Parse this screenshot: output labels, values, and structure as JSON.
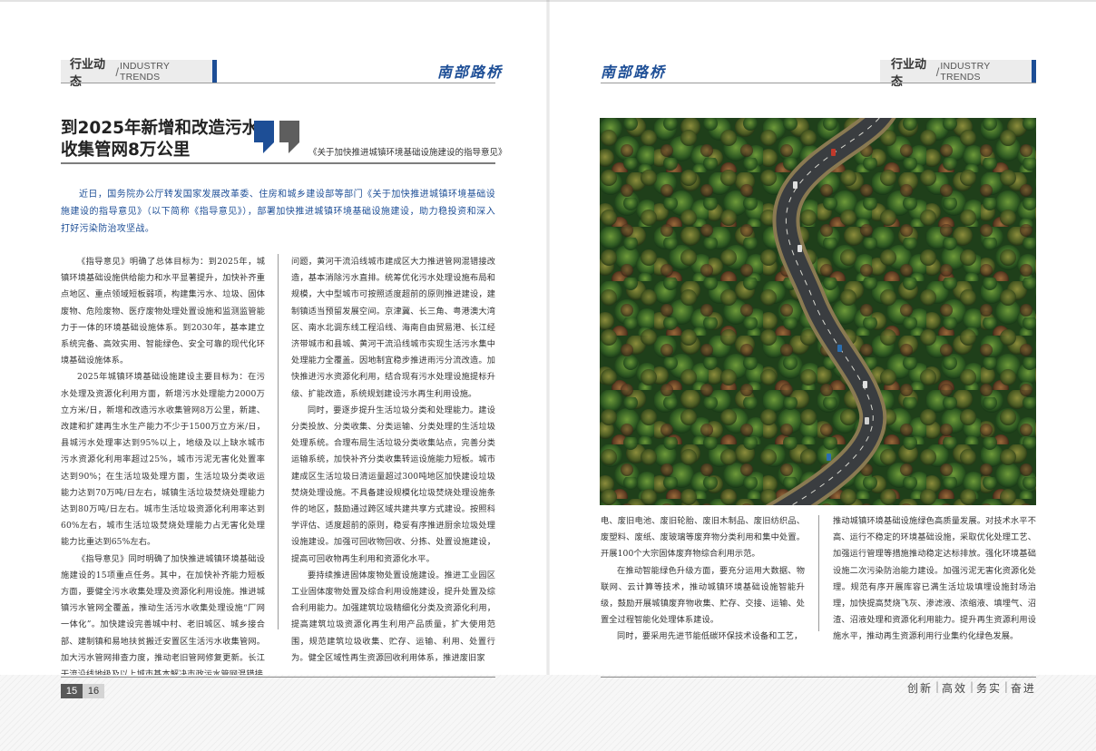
{
  "header": {
    "section_cn": "行业动态",
    "section_slash": "/",
    "section_en": "INDUSTRY TRENDS",
    "logo": "南部路桥",
    "colors": {
      "accent": "#1d4e96",
      "tab_bg": "#ececec"
    }
  },
  "article": {
    "title_line1": "到2025年新增和改造污水",
    "title_line2": "收集管网8万公里",
    "quote_icon": "quote-mark-icon",
    "subtitle": "《关于加快推进城镇环境基础设施建设的指导意见》",
    "lead": "近日，国务院办公厅转发国家发展改革委、住房和城乡建设部等部门《关于加快推进城镇环境基础设施建设的指导意见》（以下简称《指导意见》），部署加快推进城镇环境基础设施建设，助力稳投资和深入打好污染防治攻坚战。",
    "col1": [
      "《指导意见》明确了总体目标为：到2025年，城镇环境基础设施供给能力和水平显著提升，加快补齐重点地区、重点领域短板弱项，构建集污水、垃圾、固体废物、危险废物、医疗废物处理处置设施和监测监管能力于一体的环境基础设施体系。到2030年，基本建立系统完备、高效实用、智能绿色、安全可靠的现代化环境基础设施体系。",
      "2025年城镇环境基础设施建设主要目标为：在污水处理及资源化利用方面，新增污水处理能力2000万立方米/日，新增和改造污水收集管网8万公里，新建、改建和扩建再生水生产能力不少于1500万立方米/日，县城污水处理率达到95%以上，地级及以上缺水城市污水资源化利用率超过25%，城市污泥无害化处置率达到90%；在生活垃圾处理方面，生活垃圾分类收运能力达到70万吨/日左右，城镇生活垃圾焚烧处理能力达到80万吨/日左右。城市生活垃圾资源化利用率达到60%左右，城市生活垃圾焚烧处理能力占无害化处理能力比重达到65%左右。",
      "《指导意见》同时明确了加快推进城镇环境基础设施建设的15项重点任务。其中，在加快补齐能力短板方面，要健全污水收集处理及资源化利用设施。推进城镇污水管网全覆盖，推动生活污水收集处理设施“厂网一体化”。加快建设完善城中村、老旧城区、城乡接合部、建制镇和易地扶贫搬迁安置区生活污水收集管网。加大污水管网排查力度，推动老旧管网修复更新。长江干流沿线地级及以上城市基本解决市政污水管网混错接"
    ],
    "col2": [
      "问题，黄河干流沿线城市建成区大力推进管网混错接改造，基本消除污水直排。统筹优化污水处理设施布局和规模，大中型城市可按照适度超前的原则推进建设，建制镇适当预留发展空间。京津冀、长三角、粤港澳大湾区、南水北调东线工程沿线、海南自由贸易港、长江经济带城市和县城、黄河干流沿线城市实现生活污水集中处理能力全覆盖。因地制宜稳步推进雨污分流改造。加快推进污水资源化利用，结合现有污水处理设施提标升级、扩能改造，系统规划建设污水再生利用设施。",
      "同时，要逐步提升生活垃圾分类和处理能力。建设分类投放、分类收集、分类运输、分类处理的生活垃圾处理系统。合理布局生活垃圾分类收集站点，完善分类运输系统，加快补齐分类收集转运设施能力短板。城市建成区生活垃圾日清运量超过300吨地区加快建设垃圾焚烧处理设施。不具备建设规模化垃圾焚烧处理设施条件的地区，鼓励通过跨区域共建共享方式建设。按照科学评估、适度超前的原则，稳妥有序推进厨余垃圾处理设施建设。加强可回收物回收、分拣、处置设施建设，提高可回收物再生利用和资源化水平。",
      "要持续推进固体废物处置设施建设。推进工业园区工业固体废物处置及综合利用设施建设，提升处置及综合利用能力。加强建筑垃圾精细化分类及资源化利用，提高建筑垃圾资源化再生利用产品质量，扩大使用范围，规范建筑垃圾收集、贮存、运输、利用、处置行为。健全区域性再生资源回收利用体系，推进废旧家"
    ],
    "col3": [
      "电、废旧电池、废旧轮胎、废旧木制品、废旧纺织品、废塑料、废纸、废玻璃等废弃物分类利用和集中处置。开展100个大宗固体废弃物综合利用示范。",
      "在推动智能绿色升级方面，要充分运用大数据、物联网、云计算等技术，推动城镇环境基础设施智能升级，鼓励开展城镇废弃物收集、贮存、交接、运输、处置全过程智能化处理体系建设。",
      "同时，要采用先进节能低碳环保技术设备和工艺，"
    ],
    "col4": [
      "推动城镇环境基础设施绿色高质量发展。对技术水平不高、运行不稳定的环境基础设施，采取优化处理工艺、加强运行管理等措施推动稳定达标排放。强化环境基础设施二次污染防治能力建设。加强污泥无害化资源化处理。规范有序开展库容已满生活垃圾填埋设施封场治理，加快提高焚烧飞灰、渗滤液、浓缩液、填埋气、沼渣、沼液处理和资源化利用能力。提升再生资源利用设施水平，推动再生资源利用行业集约化绿色发展。"
    ],
    "photo_icon": "forest-road-aerial-photo"
  },
  "footer": {
    "page_left": "15",
    "page_right": "16",
    "slogan": [
      "创新",
      "高效",
      "务实",
      "奋进"
    ]
  }
}
